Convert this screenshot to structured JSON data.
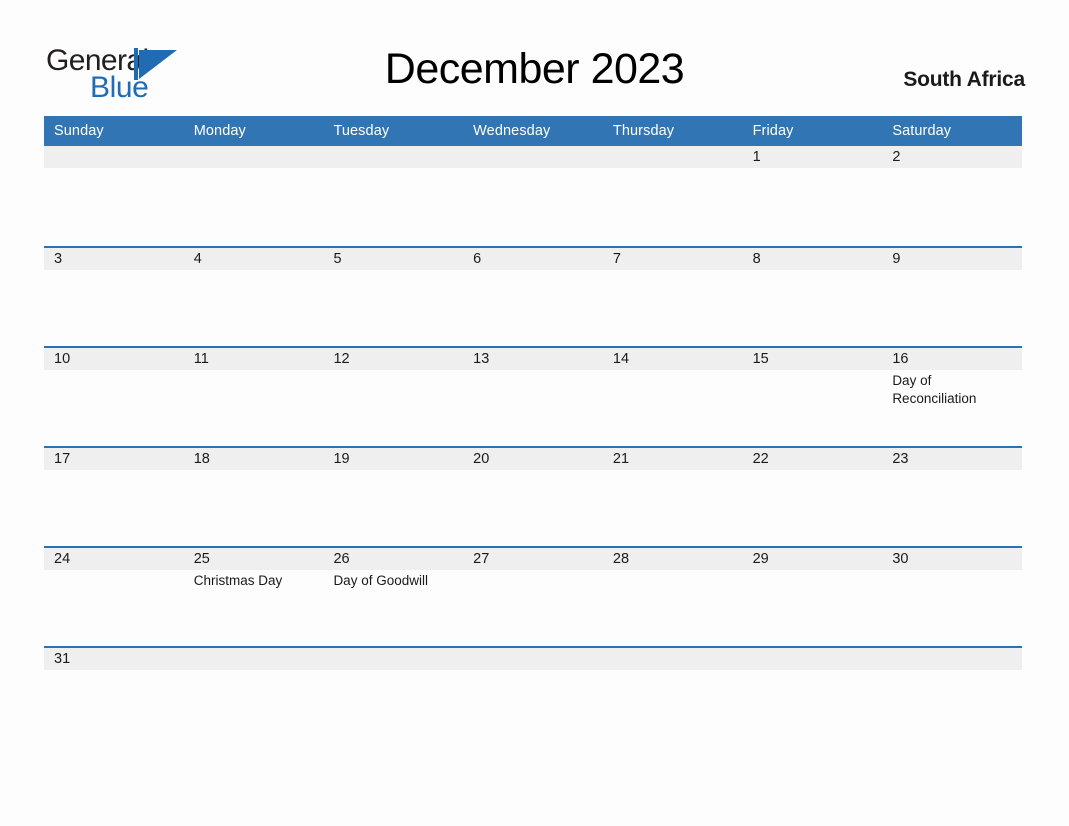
{
  "brand": {
    "name_part1": "General",
    "name_part2": "Blue",
    "mark": "triangle-flag-icon",
    "color_dark": "#231f20",
    "color_blue": "#1f6cb4"
  },
  "header": {
    "title": "December 2023",
    "country": "South Africa"
  },
  "theme": {
    "header_blue": "#3275b5",
    "rule_blue": "#2a72b5",
    "band_gray": "#efefef",
    "page_background": "#fdfdfd",
    "text": "#1a1a1a"
  },
  "calendar": {
    "month": "December",
    "year": "2023",
    "weekday_headers": [
      "Sunday",
      "Monday",
      "Tuesday",
      "Wednesday",
      "Thursday",
      "Friday",
      "Saturday"
    ],
    "weeks": [
      [
        {
          "date": "",
          "event": ""
        },
        {
          "date": "",
          "event": ""
        },
        {
          "date": "",
          "event": ""
        },
        {
          "date": "",
          "event": ""
        },
        {
          "date": "",
          "event": ""
        },
        {
          "date": "1",
          "event": ""
        },
        {
          "date": "2",
          "event": ""
        }
      ],
      [
        {
          "date": "3",
          "event": ""
        },
        {
          "date": "4",
          "event": ""
        },
        {
          "date": "5",
          "event": ""
        },
        {
          "date": "6",
          "event": ""
        },
        {
          "date": "7",
          "event": ""
        },
        {
          "date": "8",
          "event": ""
        },
        {
          "date": "9",
          "event": ""
        }
      ],
      [
        {
          "date": "10",
          "event": ""
        },
        {
          "date": "11",
          "event": ""
        },
        {
          "date": "12",
          "event": ""
        },
        {
          "date": "13",
          "event": ""
        },
        {
          "date": "14",
          "event": ""
        },
        {
          "date": "15",
          "event": ""
        },
        {
          "date": "16",
          "event": "Day of Reconciliation"
        }
      ],
      [
        {
          "date": "17",
          "event": ""
        },
        {
          "date": "18",
          "event": ""
        },
        {
          "date": "19",
          "event": ""
        },
        {
          "date": "20",
          "event": ""
        },
        {
          "date": "21",
          "event": ""
        },
        {
          "date": "22",
          "event": ""
        },
        {
          "date": "23",
          "event": ""
        }
      ],
      [
        {
          "date": "24",
          "event": ""
        },
        {
          "date": "25",
          "event": "Christmas Day"
        },
        {
          "date": "26",
          "event": "Day of Goodwill"
        },
        {
          "date": "27",
          "event": ""
        },
        {
          "date": "28",
          "event": ""
        },
        {
          "date": "29",
          "event": ""
        },
        {
          "date": "30",
          "event": ""
        }
      ],
      [
        {
          "date": "31",
          "event": ""
        },
        {
          "date": "",
          "event": ""
        },
        {
          "date": "",
          "event": ""
        },
        {
          "date": "",
          "event": ""
        },
        {
          "date": "",
          "event": ""
        },
        {
          "date": "",
          "event": ""
        },
        {
          "date": "",
          "event": ""
        }
      ]
    ]
  }
}
